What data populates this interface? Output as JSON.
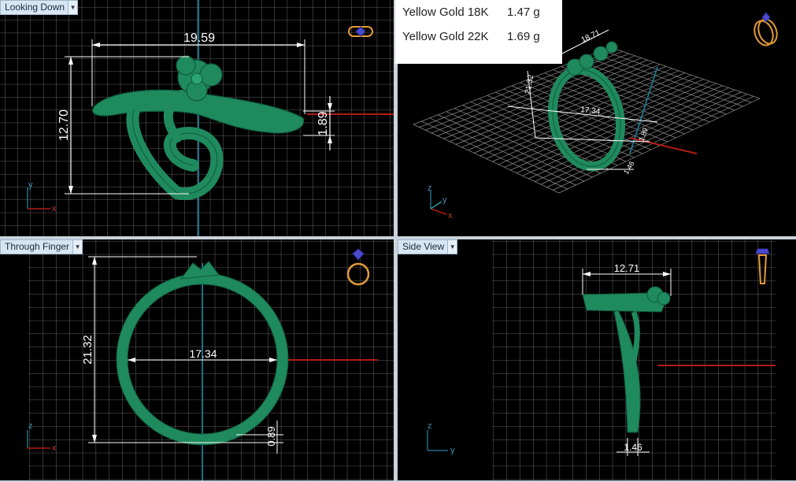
{
  "viewports": {
    "top": {
      "label": "Looking Down",
      "dims": {
        "width": "19.59",
        "height": "12.70",
        "thickness": "1.89"
      }
    },
    "perspective": {
      "dims": {
        "a": "18.71",
        "b": "21.32",
        "c": "17.34",
        "d": "1.89",
        "e": "1.46"
      }
    },
    "front": {
      "label": "Through Finger",
      "dims": {
        "height": "21.32",
        "inner": "17.34",
        "shank": "0.89"
      }
    },
    "side": {
      "label": "Side View",
      "dims": {
        "width": "12.71",
        "base": "1.46"
      }
    }
  },
  "weights": [
    {
      "metal": "Yellow Gold 18K",
      "weight": "1.47 g"
    },
    {
      "metal": "Yellow Gold 22K",
      "weight": "1.69 g"
    }
  ],
  "axes": {
    "x": "x",
    "y": "y",
    "z": "z"
  },
  "icons": [
    "dropdown-arrow-icon",
    "ring-top-icon",
    "ring-perspective-icon",
    "ring-front-icon",
    "ring-side-icon"
  ],
  "colors": {
    "model": "#1f8a5e",
    "x_axis": "#b01c16",
    "y_axis": "#1d6f86",
    "grid": "#8a8a8a",
    "label_bg": "#d7e6f3"
  }
}
